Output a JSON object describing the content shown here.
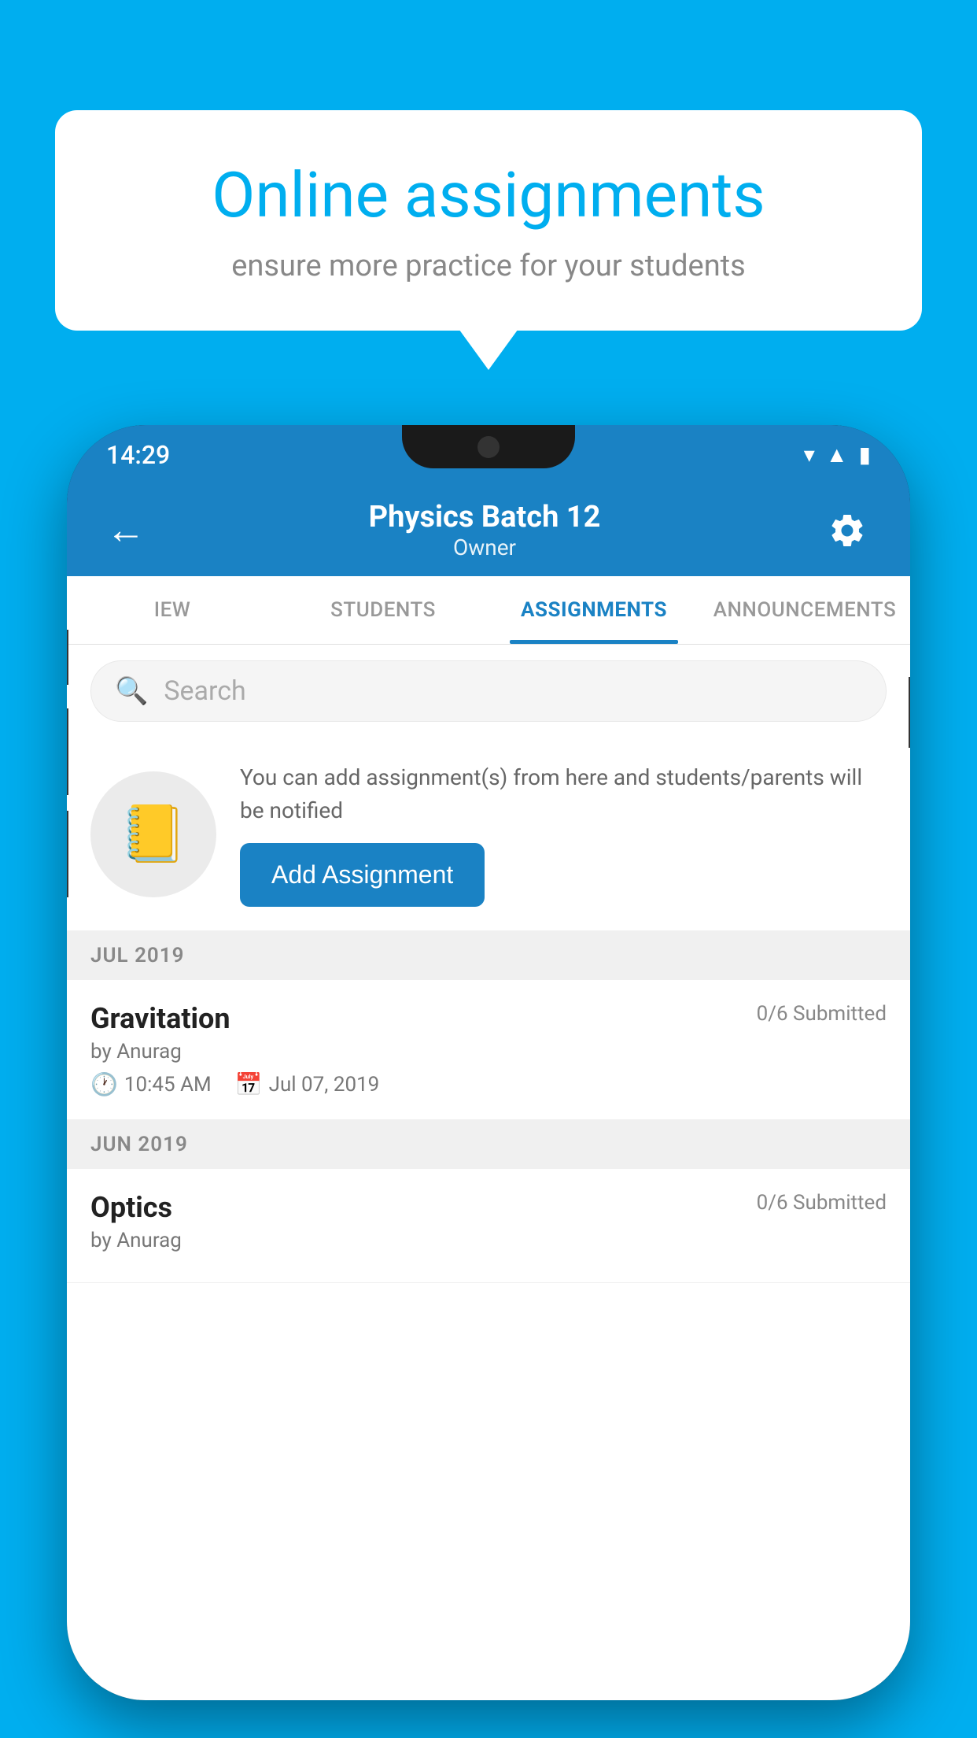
{
  "background": {
    "color": "#00AEEF"
  },
  "speech_bubble": {
    "title": "Online assignments",
    "subtitle": "ensure more practice for your students"
  },
  "phone": {
    "status_bar": {
      "time": "14:29",
      "icons": [
        "wifi",
        "signal",
        "battery"
      ]
    },
    "header": {
      "title": "Physics Batch 12",
      "subtitle": "Owner",
      "back_label": "←",
      "settings_label": "⚙"
    },
    "tabs": [
      {
        "label": "IEW",
        "active": false
      },
      {
        "label": "STUDENTS",
        "active": false
      },
      {
        "label": "ASSIGNMENTS",
        "active": true
      },
      {
        "label": "ANNOUNCEMENTS",
        "active": false
      }
    ],
    "search": {
      "placeholder": "Search"
    },
    "promo": {
      "description": "You can add assignment(s) from here and students/parents will be notified",
      "add_button_label": "Add Assignment"
    },
    "sections": [
      {
        "label": "JUL 2019",
        "assignments": [
          {
            "name": "Gravitation",
            "status": "0/6 Submitted",
            "author": "by Anurag",
            "time": "10:45 AM",
            "date": "Jul 07, 2019"
          }
        ]
      },
      {
        "label": "JUN 2019",
        "assignments": [
          {
            "name": "Optics",
            "status": "0/6 Submitted",
            "author": "by Anurag",
            "time": "",
            "date": ""
          }
        ]
      }
    ]
  }
}
